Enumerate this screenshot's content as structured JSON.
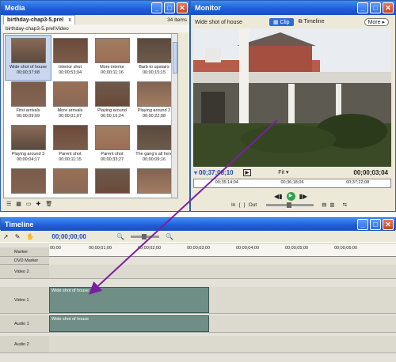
{
  "media": {
    "title": "Media",
    "tab_label": "birthday-chap3-5.prel",
    "item_count": "34 Items",
    "path": "birthday-chap3-5.prel\\Video",
    "items": [
      {
        "name": "Wide shot of house",
        "time": "00;00;37;08"
      },
      {
        "name": "Interior shot",
        "time": "00;00;53;04"
      },
      {
        "name": "More interior",
        "time": "00;00;11;16"
      },
      {
        "name": "Barb to upstairs",
        "time": "00;00;15;15"
      },
      {
        "name": "First arrivals",
        "time": "00;00;09;09"
      },
      {
        "name": "More arrivals",
        "time": "00;00;01;07"
      },
      {
        "name": "Playing around",
        "time": "00;00;16;24"
      },
      {
        "name": "Playing around 2",
        "time": "00;00;22;08"
      },
      {
        "name": "Playing around 3",
        "time": "00;00;04;17"
      },
      {
        "name": "Parent shot",
        "time": "00;00;11;15"
      },
      {
        "name": "Parent shot",
        "time": "00;00;33;27"
      },
      {
        "name": "The gang's all here",
        "time": "00;00;09;16"
      },
      {
        "name": "",
        "time": ""
      },
      {
        "name": "",
        "time": ""
      },
      {
        "name": "",
        "time": ""
      },
      {
        "name": "",
        "time": ""
      }
    ]
  },
  "monitor": {
    "title": "Monitor",
    "clip_name": "Wide shot of house",
    "tab_clip": "Clip",
    "tab_timeline": "Timeline",
    "more": "More ▸",
    "timecode_left": "00;37;08;10",
    "fit": "Fit",
    "timecode_right": "00;00;03;04",
    "ruler_labels": [
      "00;35;14;04",
      "00;36;18;06",
      "00;37;22;08"
    ],
    "in_label": "In",
    "out_label": "Out"
  },
  "timeline": {
    "title": "Timeline",
    "timecode": "00;00;00;00",
    "ruler_labels": [
      "00;00",
      "00;00;01;00",
      "00;00;02;00",
      "00;00;03;00",
      "00;00;04;00",
      "00;00;05;00",
      "00;00;06;00"
    ],
    "tracks": [
      {
        "name": "Marker",
        "clip": ""
      },
      {
        "name": "DVD Marker",
        "clip": ""
      },
      {
        "name": "Video 2",
        "clip": ""
      },
      {
        "name": "Video 1",
        "clip": "Wide shot of house"
      },
      {
        "name": "Audio 1",
        "clip": "Wide shot of house"
      },
      {
        "name": "Audio 2",
        "clip": ""
      }
    ]
  },
  "colors": {
    "titlebar": "#1d5bd6",
    "arrow": "#7a1fa0",
    "clip": "#6f8f86"
  }
}
